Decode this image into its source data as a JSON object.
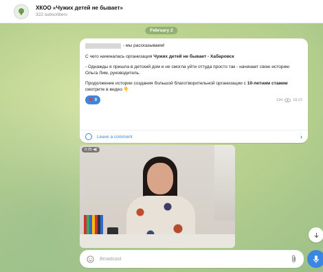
{
  "header": {
    "title": "ХКОО «Чужих детей не бывает»",
    "subscribers": "322 subscribers"
  },
  "chat": {
    "date": "February 2"
  },
  "post": {
    "greeting": "- мы рассказываем!",
    "line2_prefix": "С чего начиналась организация ",
    "line2_bold": "Чужих детей не бывает - Хабаровск",
    "line3": "- Однажды я пришла в детский дом и не смогла уйти оттуда просто так - начинает свою историю Ольга Лим, руководитель.",
    "line4_prefix": "Продолжение истории создания большой благотворительной организации с ",
    "line4_bold": "10-летним стажем",
    "line4_suffix": " смотрите в видео 👇",
    "reaction_count": "9",
    "views": "194",
    "time": "18:22",
    "comment_label": "Leave a comment"
  },
  "video": {
    "badge": "0:35 ◀)"
  },
  "composer": {
    "placeholder": "Broadcast"
  },
  "colors": {
    "accent": "#3a86e0",
    "reaction_heart": "#e43b3b"
  },
  "icons": {
    "avatar": "tree-logo-icon",
    "views": "eye-icon",
    "comment": "comment-icon",
    "chevron": "chevron-right-icon",
    "emoji": "smile-icon",
    "attach": "paperclip-icon",
    "mic": "microphone-icon",
    "scroll_down": "arrow-down-icon"
  }
}
